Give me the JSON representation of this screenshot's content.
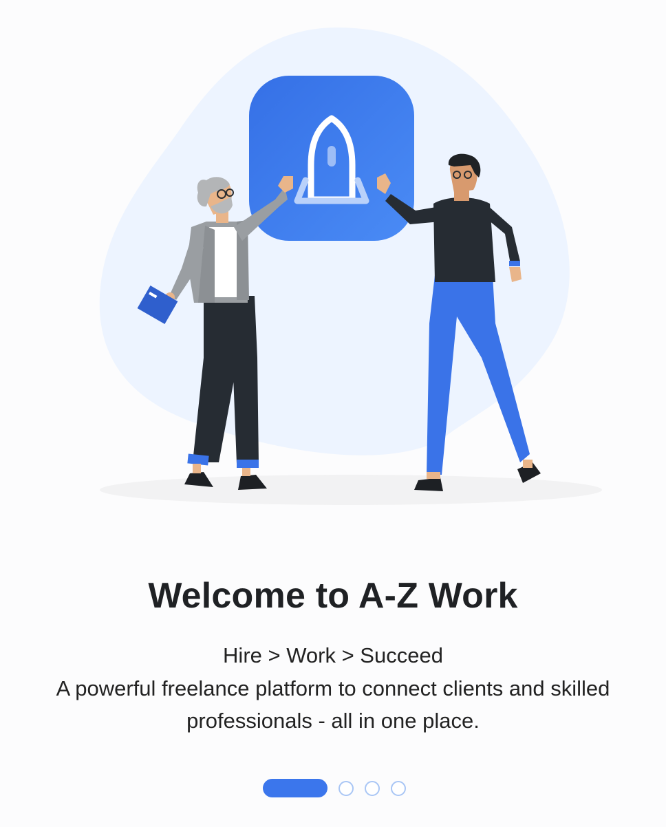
{
  "onboarding": {
    "title": "Welcome to A-Z Work",
    "tagline": "Hire > Work > Succeed",
    "description": "A powerful freelance platform to connect clients and skilled professionals - all in one place.",
    "pager": {
      "total": 4,
      "current": 1
    }
  },
  "icons": [
    "boat-icon",
    "book-icon"
  ],
  "colors": {
    "accent": "#3b76ec",
    "blob": "#edf4ff",
    "dot_inactive": "#a9c6f5",
    "title": "#1f2124"
  }
}
